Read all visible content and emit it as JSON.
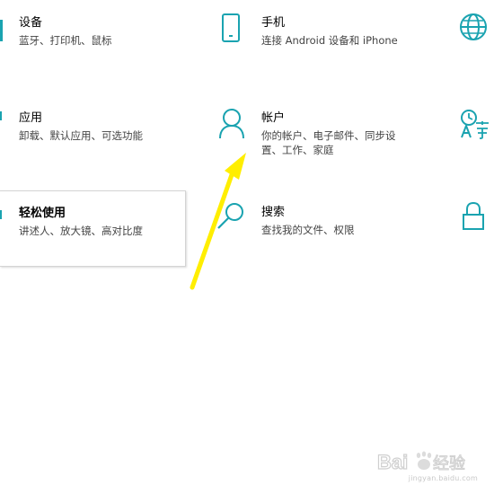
{
  "tiles": {
    "devices": {
      "title": "设备",
      "desc": "蓝牙、打印机、鼠标"
    },
    "phone": {
      "title": "手机",
      "desc": "连接 Android 设备和 iPhone"
    },
    "apps": {
      "title": "应用",
      "desc": "卸载、默认应用、可选功能"
    },
    "accounts": {
      "title": "帐户",
      "desc": "你的帐户、电子邮件、同步设置、工作、家庭"
    },
    "ease": {
      "title": "轻松使用",
      "desc": "讲述人、放大镜、高对比度"
    },
    "search": {
      "title": "搜索",
      "desc": "查找我的文件、权限"
    }
  },
  "icons": {
    "phone": "phone-icon",
    "accounts": "person-icon",
    "search": "search-icon",
    "network": "globe-icon",
    "time_language": "time-language-icon",
    "privacy": "lock-icon"
  },
  "colors": {
    "accent": "#1aa3b0",
    "arrow": "#ffee00"
  },
  "watermark": {
    "text": "Bai 经验",
    "url": "jingyan.baidu.com"
  }
}
